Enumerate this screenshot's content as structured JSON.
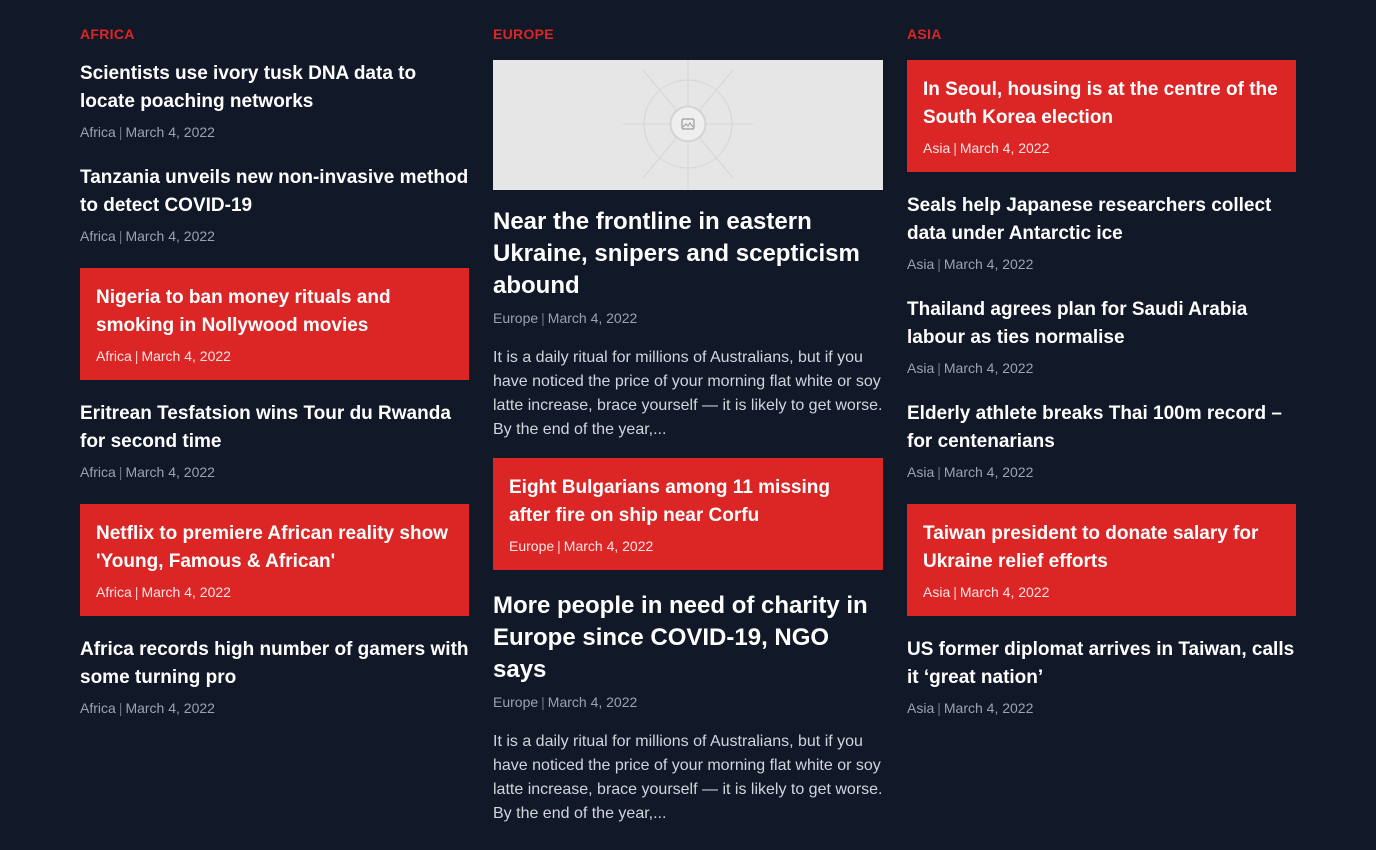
{
  "africa": {
    "title": "AFRICA",
    "items": [
      {
        "headline": "Scientists use ivory tusk DNA data to locate poaching networks",
        "category": "Africa",
        "date": "March 4, 2022",
        "highlight": false
      },
      {
        "headline": "Tanzania unveils new non-invasive method to detect COVID-19",
        "category": "Africa",
        "date": "March 4, 2022",
        "highlight": false
      },
      {
        "headline": "Nigeria to ban money rituals and smoking in Nollywood movies",
        "category": "Africa",
        "date": "March 4, 2022",
        "highlight": true
      },
      {
        "headline": "Eritrean Tesfatsion wins Tour du Rwanda for second time",
        "category": "Africa",
        "date": "March 4, 2022",
        "highlight": false
      },
      {
        "headline": "Netflix to premiere African reality show 'Young, Famous & African'",
        "category": "Africa",
        "date": "March 4, 2022",
        "highlight": true
      },
      {
        "headline": "Africa records high number of gamers with some turning pro",
        "category": "Africa",
        "date": "March 4, 2022",
        "highlight": false
      }
    ]
  },
  "europe": {
    "title": "EUROPE",
    "image_icon": "image-placeholder-icon",
    "features": [
      {
        "headline": "Near the frontline in eastern Ukraine, snipers and scepticism abound",
        "category": "Europe",
        "date": "March 4, 2022",
        "excerpt": "It is a daily ritual for millions of Australians, but if you have noticed the price of your morning flat white or soy latte increase, brace yourself — it is likely to get worse. By the end of the year,..."
      },
      {
        "headline": "More people in need of charity in Europe since COVID-19, NGO says",
        "category": "Europe",
        "date": "March 4, 2022",
        "excerpt": "It is a daily ritual for millions of Australians, but if you have noticed the price of your morning flat white or soy latte increase, brace yourself — it is likely to get worse. By the end of the year,..."
      }
    ],
    "highlight": {
      "headline": "Eight Bulgarians among 11 missing after fire on ship near Corfu",
      "category": "Europe",
      "date": "March 4, 2022"
    }
  },
  "asia": {
    "title": "ASIA",
    "items": [
      {
        "headline": "In Seoul, housing is at the centre of the South Korea election",
        "category": "Asia",
        "date": "March 4, 2022",
        "highlight": true
      },
      {
        "headline": "Seals help Japanese researchers collect data under Antarctic ice",
        "category": "Asia",
        "date": "March 4, 2022",
        "highlight": false
      },
      {
        "headline": "Thailand agrees plan for Saudi Arabia labour as ties normalise",
        "category": "Asia",
        "date": "March 4, 2022",
        "highlight": false
      },
      {
        "headline": "Elderly athlete breaks Thai 100m record – for centenarians",
        "category": "Asia",
        "date": "March 4, 2022",
        "highlight": false
      },
      {
        "headline": "Taiwan president to donate salary for Ukraine relief efforts",
        "category": "Asia",
        "date": "March 4, 2022",
        "highlight": true
      },
      {
        "headline": "US former diplomat arrives in Taiwan, calls it ‘great nation’",
        "category": "Asia",
        "date": "March 4, 2022",
        "highlight": false
      }
    ]
  },
  "colors": {
    "background": "#111827",
    "accent": "#dc2626",
    "meta": "#9ca3af",
    "excerpt": "#d1d5db"
  }
}
